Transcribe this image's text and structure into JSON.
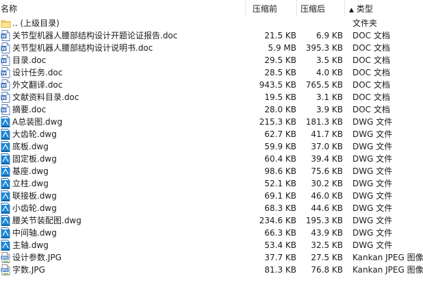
{
  "columns": {
    "name": "名称",
    "original_size": "压缩前",
    "compressed_size": "压缩后",
    "type": "类型",
    "sort_indicator": "▲"
  },
  "files": [
    {
      "icon": "folder-up-icon",
      "name": ".. (上级目录)",
      "original": "",
      "compressed": "",
      "type": "文件夹"
    },
    {
      "icon": "doc-file-icon",
      "name": "关节型机器人腰部结构设计开题论证报告.doc",
      "original": "21.5 KB",
      "compressed": "6.9 KB",
      "type": "DOC 文档"
    },
    {
      "icon": "doc-file-icon",
      "name": "关节型机器人腰部结构设计说明书.doc",
      "original": "5.9 MB",
      "compressed": "395.3 KB",
      "type": "DOC 文档"
    },
    {
      "icon": "doc-file-icon",
      "name": "目录.doc",
      "original": "29.5 KB",
      "compressed": "3.5 KB",
      "type": "DOC 文档"
    },
    {
      "icon": "doc-file-icon",
      "name": "设计任务.doc",
      "original": "28.5 KB",
      "compressed": "4.0 KB",
      "type": "DOC 文档"
    },
    {
      "icon": "doc-file-icon",
      "name": "外文翻译.doc",
      "original": "943.5 KB",
      "compressed": "765.5 KB",
      "type": "DOC 文档"
    },
    {
      "icon": "doc-file-icon",
      "name": "文献资料目录.doc",
      "original": "19.5 KB",
      "compressed": "3.1 KB",
      "type": "DOC 文档"
    },
    {
      "icon": "doc-file-icon",
      "name": "摘要.doc",
      "original": "28.0 KB",
      "compressed": "3.9 KB",
      "type": "DOC 文档"
    },
    {
      "icon": "dwg-file-icon",
      "name": "A总装图.dwg",
      "original": "215.3 KB",
      "compressed": "181.3 KB",
      "type": "DWG 文件"
    },
    {
      "icon": "dwg-file-icon",
      "name": "大齿轮.dwg",
      "original": "62.7 KB",
      "compressed": "41.7 KB",
      "type": "DWG 文件"
    },
    {
      "icon": "dwg-file-icon",
      "name": "底板.dwg",
      "original": "59.9 KB",
      "compressed": "37.0 KB",
      "type": "DWG 文件"
    },
    {
      "icon": "dwg-file-icon",
      "name": "固定板.dwg",
      "original": "60.4 KB",
      "compressed": "39.4 KB",
      "type": "DWG 文件"
    },
    {
      "icon": "dwg-file-icon",
      "name": "基座.dwg",
      "original": "98.6 KB",
      "compressed": "75.6 KB",
      "type": "DWG 文件"
    },
    {
      "icon": "dwg-file-icon",
      "name": "立柱.dwg",
      "original": "52.1 KB",
      "compressed": "30.2 KB",
      "type": "DWG 文件"
    },
    {
      "icon": "dwg-file-icon",
      "name": "联接板.dwg",
      "original": "69.1 KB",
      "compressed": "46.0 KB",
      "type": "DWG 文件"
    },
    {
      "icon": "dwg-file-icon",
      "name": "小齿轮.dwg",
      "original": "68.3 KB",
      "compressed": "44.6 KB",
      "type": "DWG 文件"
    },
    {
      "icon": "dwg-file-icon",
      "name": "腰关节装配图.dwg",
      "original": "234.6 KB",
      "compressed": "195.3 KB",
      "type": "DWG 文件"
    },
    {
      "icon": "dwg-file-icon",
      "name": "中间轴.dwg",
      "original": "66.3 KB",
      "compressed": "43.9 KB",
      "type": "DWG 文件"
    },
    {
      "icon": "dwg-file-icon",
      "name": "主轴.dwg",
      "original": "53.4 KB",
      "compressed": "32.5 KB",
      "type": "DWG 文件"
    },
    {
      "icon": "jpg-file-icon",
      "name": "设计参数.JPG",
      "original": "37.7 KB",
      "compressed": "27.5 KB",
      "type": "Kankan JPEG 图像"
    },
    {
      "icon": "jpg-file-icon",
      "name": "字数.JPG",
      "original": "81.3 KB",
      "compressed": "76.8 KB",
      "type": "Kankan JPEG 图像"
    }
  ]
}
